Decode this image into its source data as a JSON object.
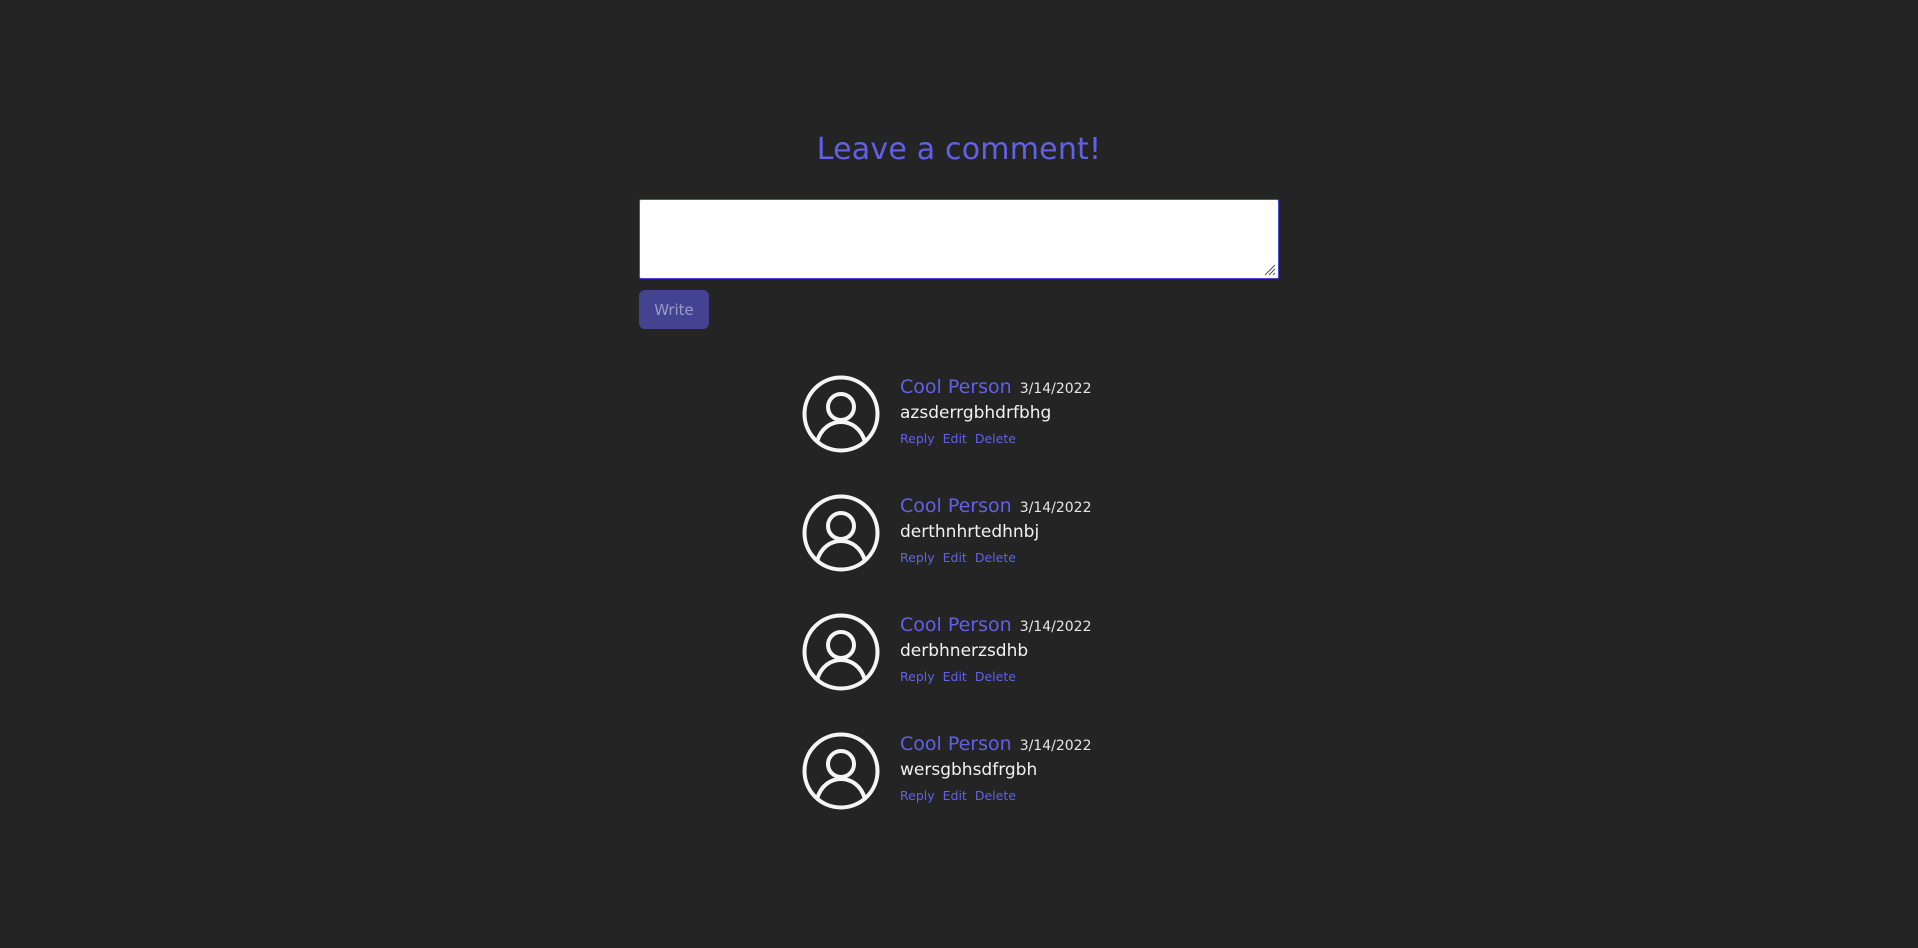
{
  "heading": "Leave a comment!",
  "comment_input": {
    "value": "",
    "placeholder": ""
  },
  "write_button": "Write",
  "colors": {
    "background": "#242424",
    "accent": "#6161e8",
    "button": "#434392",
    "button_text": "#9a9ac6",
    "text": "#f2f2f2"
  },
  "comments": [
    {
      "avatar_icon": "user-circle-icon",
      "author": "Cool Person",
      "date": "3/14/2022",
      "text": "azsderrgbhdrfbhg",
      "actions": {
        "reply": "Reply",
        "edit": "Edit",
        "delete": "Delete"
      }
    },
    {
      "avatar_icon": "user-circle-icon",
      "author": "Cool Person",
      "date": "3/14/2022",
      "text": "derthnhrtedhnbj",
      "actions": {
        "reply": "Reply",
        "edit": "Edit",
        "delete": "Delete"
      }
    },
    {
      "avatar_icon": "user-circle-icon",
      "author": "Cool Person",
      "date": "3/14/2022",
      "text": "derbhnerzsdhb",
      "actions": {
        "reply": "Reply",
        "edit": "Edit",
        "delete": "Delete"
      }
    },
    {
      "avatar_icon": "user-circle-icon",
      "author": "Cool Person",
      "date": "3/14/2022",
      "text": "wersgbhsdfrgbh",
      "actions": {
        "reply": "Reply",
        "edit": "Edit",
        "delete": "Delete"
      }
    }
  ]
}
